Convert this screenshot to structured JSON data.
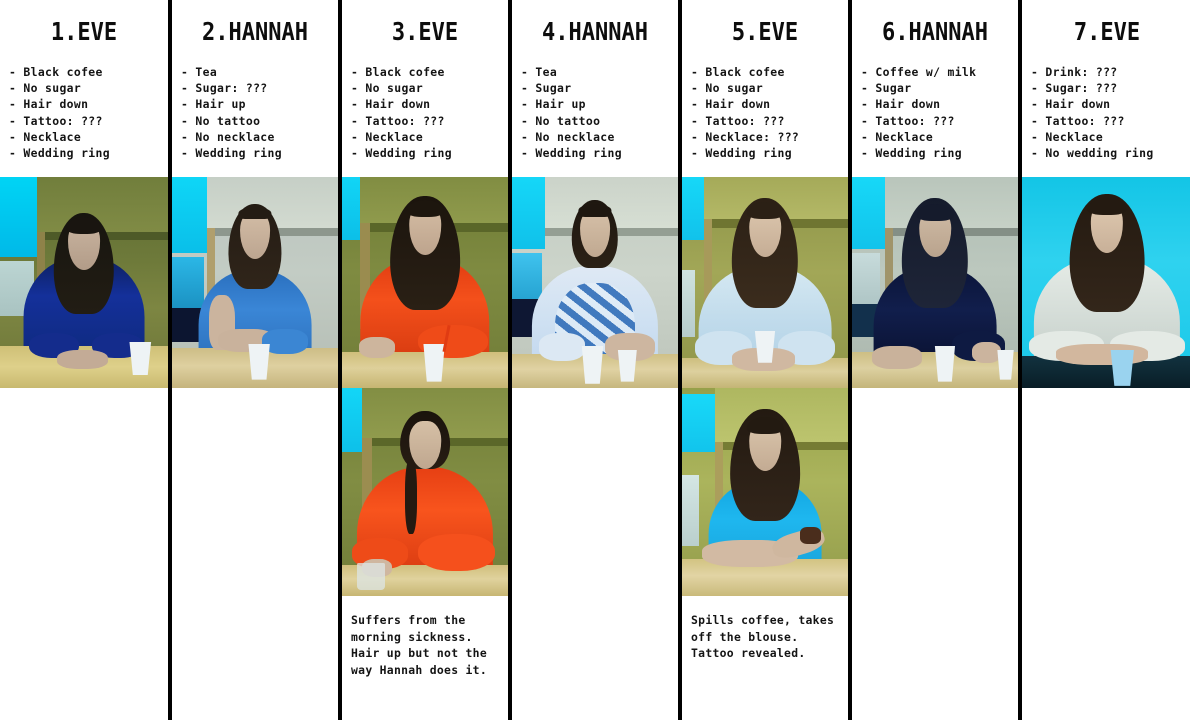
{
  "columns": [
    {
      "id": "col-1",
      "title": "1.EVE",
      "attrs": [
        "- Black cofee",
        "- No sugar",
        "- Hair down",
        "- Tattoo: ???",
        "- Necklace",
        "- Wedding ring"
      ],
      "still_alt": "Woman in dark blue jacket, hair down, seated at table with white cup",
      "second_still": null,
      "caption": null
    },
    {
      "id": "col-2",
      "title": "2.HANNAH",
      "attrs": [
        "- Tea",
        "- Sugar: ???",
        "- Hair up",
        "- No tattoo",
        "- No necklace",
        "- Wedding ring"
      ],
      "still_alt": "Woman in blue t-shirt, hair up, hand to face, white cup on table",
      "second_still": null,
      "caption": null
    },
    {
      "id": "col-3",
      "title": "3.EVE",
      "attrs": [
        "- Black cofee",
        "- No sugar",
        "- Hair down",
        "- Tattoo: ???",
        "- Necklace",
        "- Wedding ring"
      ],
      "still_alt": "Woman in orange-red jacket, hair down, white cup with red straw",
      "second_still": "Woman in orange-red jacket, hair up in ponytail, looking down at glass",
      "caption": "Suffers from the morning sickness. Hair up but not the way Hannah does it."
    },
    {
      "id": "col-4",
      "title": "4.HANNAH",
      "attrs": [
        "- Tea",
        "- Sugar",
        "- Hair up",
        "- No tattoo",
        "- No necklace",
        "- Wedding ring"
      ],
      "still_alt": "Woman in blue-patterned blouse, hair up, stirring two white cups",
      "second_still": null,
      "caption": null
    },
    {
      "id": "col-5",
      "title": "5.EVE",
      "attrs": [
        "- Black cofee",
        "- No sugar",
        "- Hair down",
        "- Tattoo: ???",
        "- Necklace: ???",
        "- Wedding ring"
      ],
      "still_alt": "Woman in pale blue shirt, hair down, holding white cup with both hands",
      "second_still": "Woman in bright blue t-shirt, arms on table, tattoo visible on forearm",
      "caption": "Spills coffee, takes off the blouse. Tattoo revealed."
    },
    {
      "id": "col-6",
      "title": "6.HANNAH",
      "attrs": [
        "- Coffee w/ milk",
        "- Sugar",
        "- Hair down",
        "- Tattoo: ???",
        "- Necklace",
        "- Wedding ring"
      ],
      "still_alt": "Woman in dark navy top, hair down, stirring white cup at table",
      "second_still": null,
      "caption": null
    },
    {
      "id": "col-7",
      "title": "7.EVE",
      "attrs": [
        "- Drink: ???",
        "- Sugar: ???",
        "- Hair down",
        "- Tattoo: ???",
        "- Necklace",
        "- No wedding ring"
      ],
      "still_alt": "Woman in white shirt against bright cyan background, blue cup on dark table",
      "second_still": null,
      "caption": null
    }
  ],
  "colors": {
    "divider": "#000000",
    "background": "#ffffff",
    "text": "#141414",
    "window_cyan": "#00c8f0",
    "desk_wood": "#d8c57a"
  }
}
